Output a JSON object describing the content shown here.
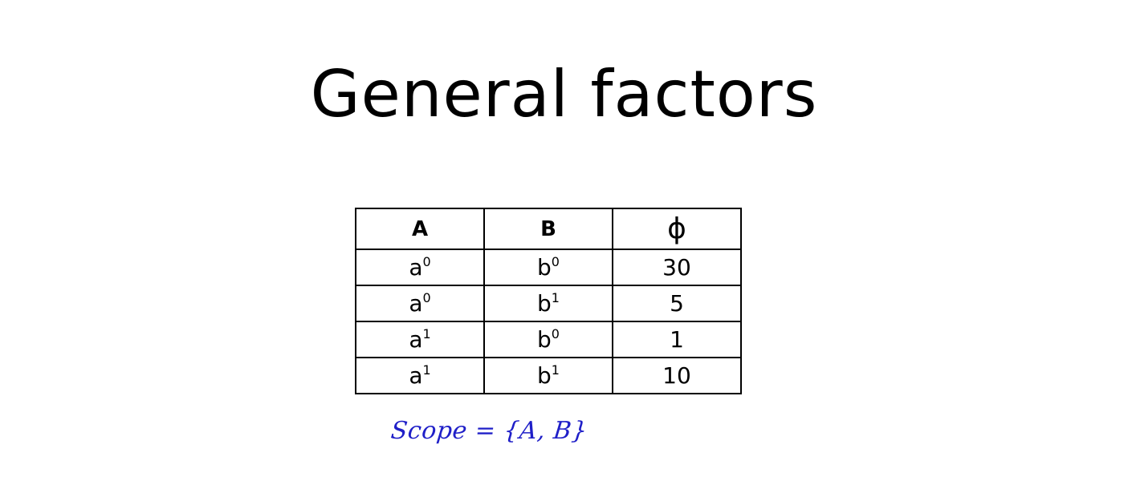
{
  "title": "General factors",
  "table": {
    "headers": [
      "A",
      "B",
      "ϕ"
    ],
    "rows": [
      {
        "a": "a",
        "a_sup": "0",
        "b": "b",
        "b_sup": "0",
        "phi": "30"
      },
      {
        "a": "a",
        "a_sup": "0",
        "b": "b",
        "b_sup": "1",
        "phi": "5"
      },
      {
        "a": "a",
        "a_sup": "1",
        "b": "b",
        "b_sup": "0",
        "phi": "1"
      },
      {
        "a": "a",
        "a_sup": "1",
        "b": "b",
        "b_sup": "1",
        "phi": "10"
      }
    ]
  },
  "annotation": {
    "text": "Scope = {A, B}",
    "color": "#1f1fc8"
  }
}
